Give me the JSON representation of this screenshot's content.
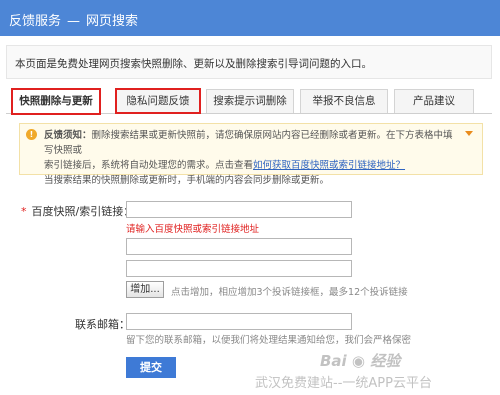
{
  "header": {
    "title_main": "反馈服务",
    "separator": "—",
    "title_sub": "网页搜索"
  },
  "intro": "本页面是免费处理网页搜索快照删除、更新以及删除搜索引导词问题的入口。",
  "tabs": [
    {
      "label": "快照删除与更新"
    },
    {
      "label": "隐私问题反馈"
    },
    {
      "label": "搜索提示词删除"
    },
    {
      "label": "举报不良信息"
    },
    {
      "label": "产品建议"
    }
  ],
  "notice": {
    "title": "反馈须知：",
    "line1": "删除搜索结果或更新快照前，请您确保原网站内容已经删除或者更新。在下方表格中填写快照或",
    "line2_pre": "索引链接后，系统将自动处理您的需求。点击查看",
    "line2_link": "如何获取百度快照或索引链接地址？",
    "line3": "当搜索结果的快照删除或更新时，手机端的内容会同步删除或更新。"
  },
  "form": {
    "required_mark": "*",
    "url_label": "百度快照/索引链接：",
    "url_error": "请输入百度快照或索引链接地址",
    "add_button": "增加...",
    "add_hint": "点击增加，相应增加3个投诉链接框，最多12个投诉链接",
    "email_label": "联系邮箱：",
    "email_hint": "留下您的联系邮箱，以便我们将处理结果通知给您，我们会严格保密",
    "submit_button": "提交"
  },
  "watermark": {
    "line1": "Bai ◉ 经验",
    "line2": "武汉免费建站--一统APP云平台"
  },
  "colors": {
    "header_bg": "#4d86d6",
    "highlight_red": "#e0201f",
    "submit_bg": "#3e7ad6",
    "notice_bg": "#fffbeb"
  }
}
